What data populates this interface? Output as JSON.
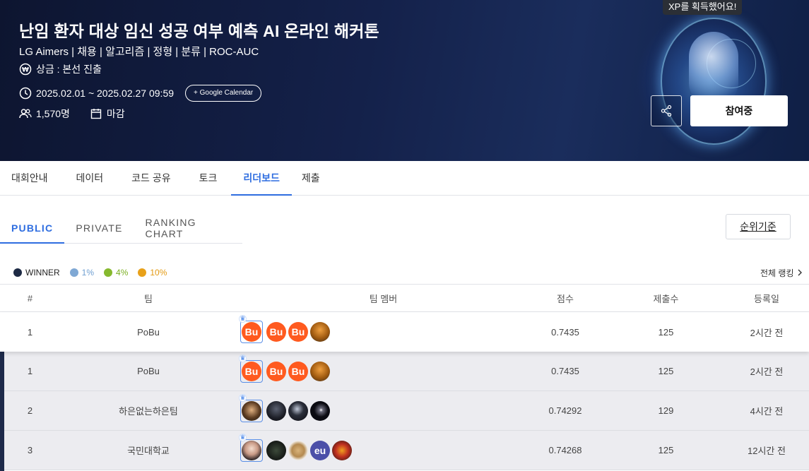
{
  "hero": {
    "toast": "XP를 획득했어요!",
    "title": "난임 환자 대상 임신 성공 여부 예측 AI 온라인 해커톤",
    "subtitle": "LG Aimers | 채용 | 알고리즘 | 정형 | 분류 | ROC-AUC",
    "prize": "상금 : 본선 진출",
    "period": "2025.02.01 ~ 2025.02.27 09:59",
    "calendar_button": "+ Google Calendar",
    "participants": "1,570명",
    "status": "마감",
    "join_button": "참여중"
  },
  "main_tabs": [
    {
      "label": "대회안내",
      "active": false
    },
    {
      "label": "데이터",
      "active": false
    },
    {
      "label": "코드 공유",
      "active": false
    },
    {
      "label": "토크",
      "active": false
    },
    {
      "label": "리더보드",
      "active": true
    },
    {
      "label": "제출",
      "active": false
    }
  ],
  "sub_tabs": [
    {
      "label": "PUBLIC",
      "active": true
    },
    {
      "label": "PRIVATE",
      "active": false
    },
    {
      "label": "RANKING CHART",
      "active": false
    }
  ],
  "rank_basis_button": "순위기준",
  "legend": [
    {
      "label": "WINNER",
      "color": "#1d2a44",
      "text_color": "#222"
    },
    {
      "label": "1%",
      "color": "#7fa8d4",
      "text_color": "#6f9fd1"
    },
    {
      "label": "4%",
      "color": "#86b92e",
      "text_color": "#7aae1f"
    },
    {
      "label": "10%",
      "color": "#e8a11a",
      "text_color": "#e39a12"
    }
  ],
  "all_ranking_link": "전체 랭킹",
  "table": {
    "headers": {
      "rank": "#",
      "team": "팀",
      "members": "팀 멤버",
      "score": "점수",
      "submissions": "제출수",
      "date": "등록일"
    },
    "my_row": {
      "rank": "1",
      "team": "PoBu",
      "score": "0.7435",
      "submissions": "125",
      "date": "2시간 전"
    },
    "rows": [
      {
        "rank": "1",
        "team": "PoBu",
        "score": "0.7435",
        "submissions": "125",
        "date": "2시간 전"
      },
      {
        "rank": "2",
        "team": "하은없는하은팀",
        "score": "0.74292",
        "submissions": "129",
        "date": "4시간 전"
      },
      {
        "rank": "3",
        "team": "국민대학교",
        "score": "0.74268",
        "submissions": "125",
        "date": "12시간 전"
      }
    ],
    "avatar_text": {
      "bu": "Bu",
      "eu": "eu"
    }
  },
  "colors": {
    "accent": "#2e6de0",
    "avatar_orange": "#ff5a1f",
    "avatar_purple": "#4b4fa8"
  }
}
